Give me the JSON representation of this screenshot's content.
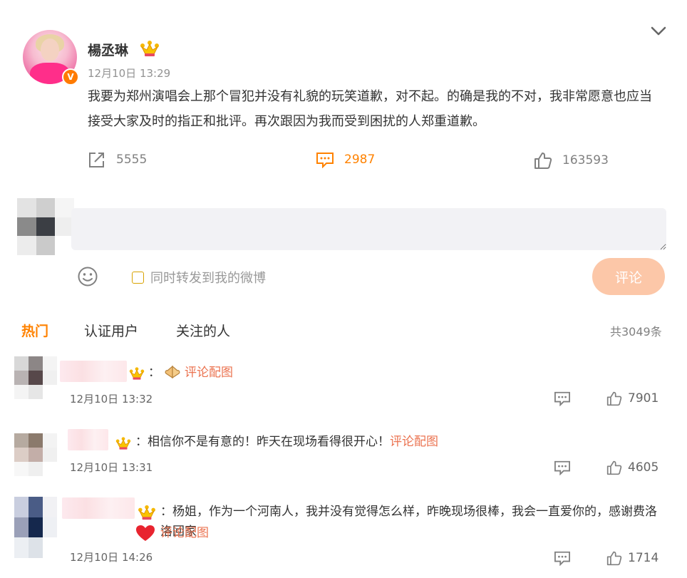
{
  "post": {
    "username": "楊丞琳",
    "verified_badge": "V",
    "timestamp": "12月10日 13:29",
    "content": "我要为郑州演唱会上那个冒犯并没有礼貌的玩笑道歉，对不起。的确是我的不对，我非常愿意也应当接受大家及时的指正和批评。再次跟因为我而受到困扰的人郑重道歉。",
    "reposts": "5555",
    "comments": "2987",
    "likes": "163593"
  },
  "composer": {
    "forward_label": "同时转发到我的微博",
    "submit_label": "评论"
  },
  "tabs": [
    {
      "label": "热门",
      "active": true
    },
    {
      "label": "认证用户",
      "active": false
    },
    {
      "label": "关注的人",
      "active": false
    }
  ],
  "total_count": "共3049条",
  "comments": [
    {
      "sep": "：",
      "text": "",
      "link": "评论配图",
      "time": "12月10日 13:32",
      "likes": "7901"
    },
    {
      "sep": "：",
      "text": "相信你不是有意的！昨天在现场看得很开心！",
      "link": "评论配图",
      "time": "12月10日 13:31",
      "likes": "4605"
    },
    {
      "sep": "：",
      "text": "杨姐，作为一个河南人，我并没有觉得怎么样，昨晚现场很棒，我会一直爱你的，感谢费洛洛回家",
      "link": "评论配图",
      "time": "12月10日 14:26",
      "likes": "1714"
    }
  ],
  "colors": {
    "accent": "#ff8200",
    "link": "#eb7350",
    "submit_disabled": "#fcc7a8",
    "input_bg": "#f2f2f5"
  },
  "icons": [
    "chevron-down-icon",
    "crown-icon",
    "repost-icon",
    "comment-icon",
    "like-icon",
    "smiley-icon",
    "palms-emoji-icon",
    "heart-emoji-icon"
  ]
}
